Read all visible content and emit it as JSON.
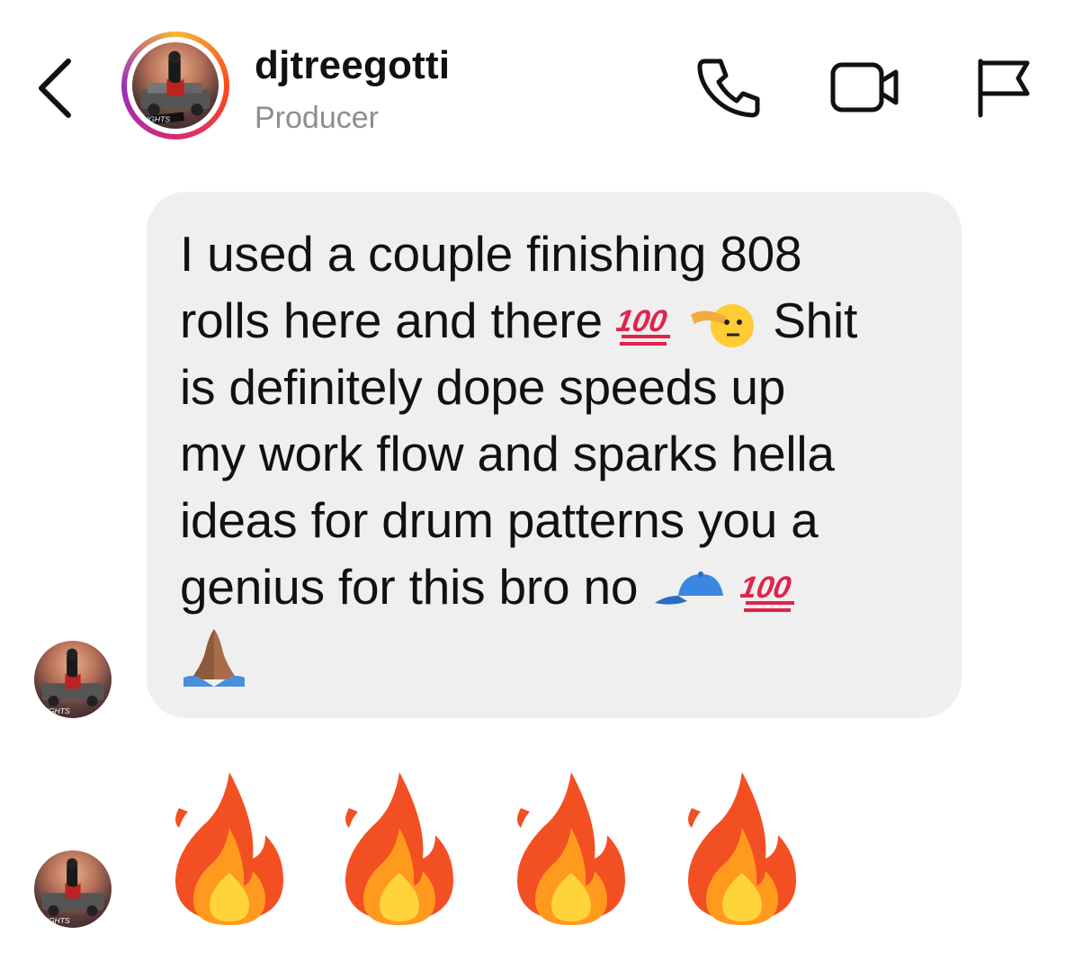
{
  "header": {
    "username": "djtreegotti",
    "subtitle": "Producer",
    "avatar_text": "FLIGHTS",
    "icons": [
      "chevron-left-icon",
      "phone-icon",
      "video-camera-icon",
      "flag-icon"
    ]
  },
  "message": {
    "line1": "I used a couple finishing 808",
    "line2a": "rolls here and there",
    "line2b": "Shit",
    "line3": "is definitely dope speeds up",
    "line4": "my work flow and sparks hella",
    "line5": "ideas for drum patterns you a",
    "line6": "genius for this bro no",
    "emojis": [
      "hundred-points",
      "saluting-face",
      "blue-cap",
      "hundred-points",
      "folded-hands"
    ]
  },
  "reaction": {
    "emojis": [
      "fire",
      "fire",
      "fire",
      "fire"
    ]
  },
  "colors": {
    "bubble": "#efefef",
    "subtitle": "#8e8e8e",
    "hundred": "#e0244a",
    "cap": "#3a86e0"
  }
}
